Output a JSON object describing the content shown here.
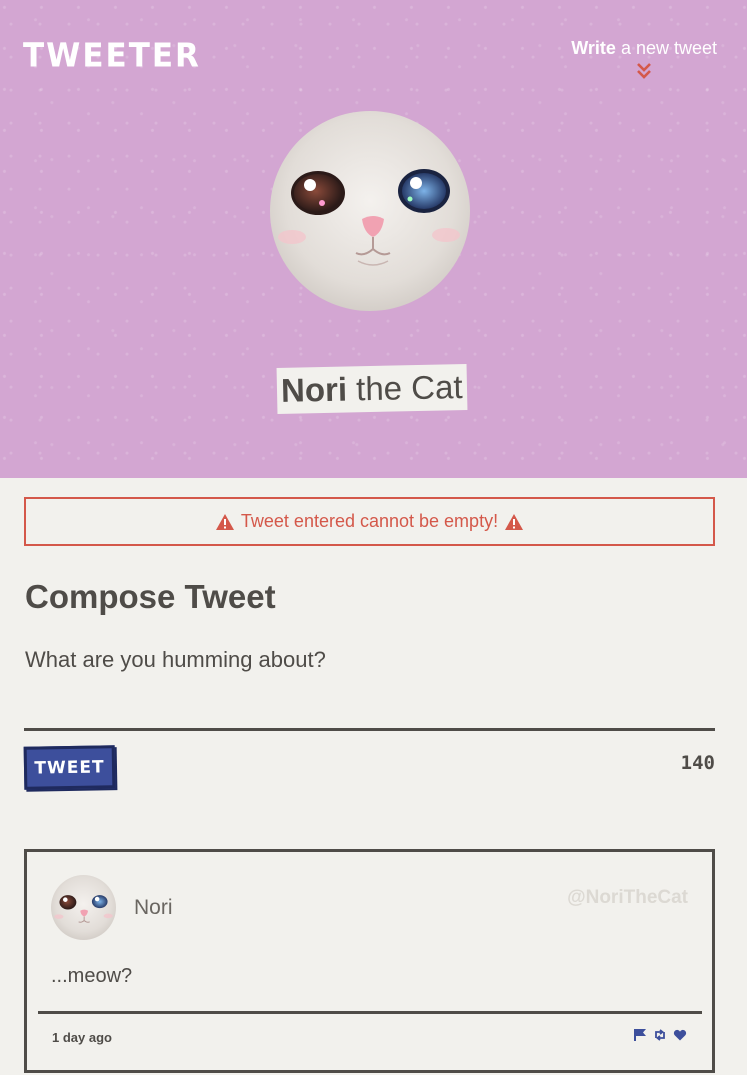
{
  "header": {
    "logo": "TWEETER",
    "write_link_bold": "Write",
    "write_link_rest": " a new tweet",
    "user_first": "Nori",
    "user_rest": " the Cat"
  },
  "error": {
    "message": " Tweet entered cannot be empty! "
  },
  "compose": {
    "title": "Compose Tweet",
    "placeholder": "What are you humming about?",
    "button_label": "TWEET",
    "counter": "140"
  },
  "tweets": [
    {
      "name": "Nori",
      "handle": "@NoriTheCat",
      "text": "...meow?",
      "time": "1 day ago"
    }
  ],
  "colors": {
    "header_bg": "#d3a6d2",
    "page_bg": "#f2f1ed",
    "accent_red": "#d4584a",
    "button_blue": "#3d4f9c",
    "text_dark": "#4f4c48"
  },
  "icons": {
    "write_arrow": "double-chevron-down-icon",
    "warning": "warning-triangle-icon",
    "flag": "flag-icon",
    "retweet": "retweet-icon",
    "like": "heart-icon"
  }
}
